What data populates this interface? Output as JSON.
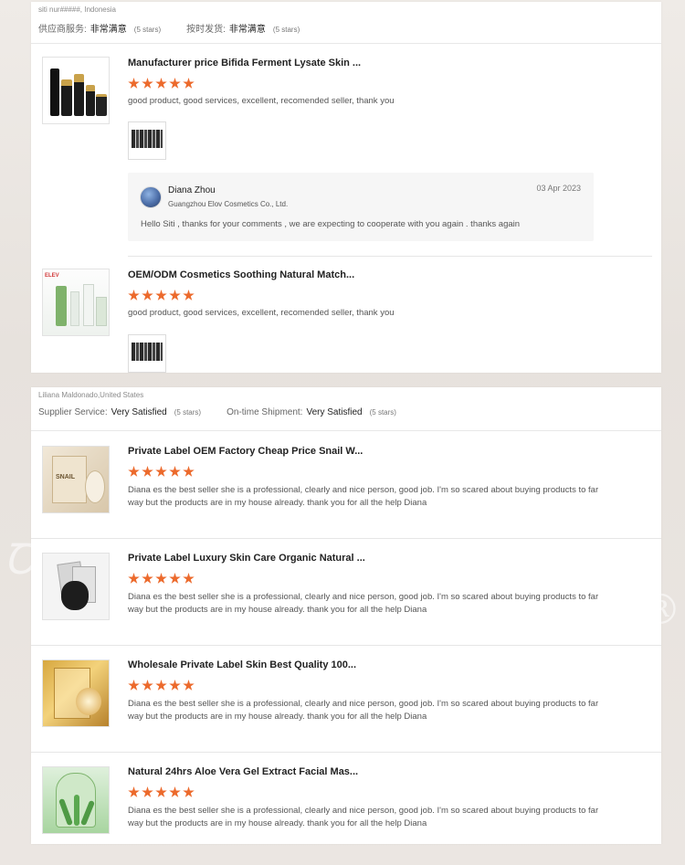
{
  "card1": {
    "reviewer": "siti nur#####, Indonesia",
    "ratings": [
      {
        "label": "供应商服务:",
        "value": "非常满意",
        "stars": "(5 stars)"
      },
      {
        "label": "按时发货:",
        "value": "非常满意",
        "stars": "(5 stars)"
      }
    ],
    "reviews": [
      {
        "title": "Manufacturer price Bifida Ferment Lysate Skin ...",
        "rating": 5,
        "comment": "good product, good services, excellent, recomended seller, thank you",
        "product_icon": "black-gold-bottles-image",
        "attachment_icon": "package-photo-thumbnail"
      },
      {
        "title": "OEM/ODM Cosmetics Soothing Natural Match...",
        "rating": 5,
        "comment": "good product, good services, excellent, recomended seller, thank you",
        "product_icon": "green-skincare-set-image",
        "brand_mark": "ELEV",
        "attachment_icon": "package-photo-thumbnail"
      }
    ],
    "reply": {
      "name": "Diana Zhou",
      "company": "Guangzhou Elov Cosmetics Co., Ltd.",
      "date": "03 Apr 2023",
      "message": "Hello Siti , thanks for your comments , we are expecting to cooperate with you again . thanks again"
    }
  },
  "card2": {
    "reviewer": "Liliana Maldonado,United States",
    "ratings": [
      {
        "label": "Supplier Service:",
        "value": "Very Satisfied",
        "stars": "(5 stars)"
      },
      {
        "label": "On-time Shipment:",
        "value": "Very Satisfied",
        "stars": "(5 stars)"
      }
    ],
    "reviews": [
      {
        "title": "Private Label OEM Factory Cheap Price Snail W...",
        "rating": 5,
        "comment": "Diana es the best seller she is a professional, clearly and nice person, good job. I'm so scared about buying products to far way but the products are in my house already. thank you for all the help Diana",
        "product_icon": "snail-mask-image",
        "label_text": "SNAIL"
      },
      {
        "title": "Private Label Luxury Skin Care Organic Natural ...",
        "rating": 5,
        "comment": "Diana es the best seller she is a professional, clearly and nice person, good job. I'm so scared about buying products to far way but the products are in my house already. thank you for all the help Diana",
        "product_icon": "black-sheet-mask-image"
      },
      {
        "title": "Wholesale Private Label Skin Best Quality 100...",
        "rating": 5,
        "comment": "Diana es the best seller she is a professional, clearly and nice person, good job. I'm so scared about buying products to far way but the products are in my house already. thank you for all the help Diana",
        "product_icon": "gold-mask-image"
      },
      {
        "title": "Natural 24hrs Aloe Vera Gel Extract Facial Mas...",
        "rating": 5,
        "comment": "Diana es the best seller she is a professional, clearly and nice person, good job. I'm so scared about buying products to far way but the products are in my house already. thank you for all the help Diana",
        "product_icon": "aloe-vera-mask-image"
      }
    ]
  },
  "colors": {
    "star": "#ec6a2c",
    "card": "#ffffff",
    "background": "#ebe6e2"
  }
}
